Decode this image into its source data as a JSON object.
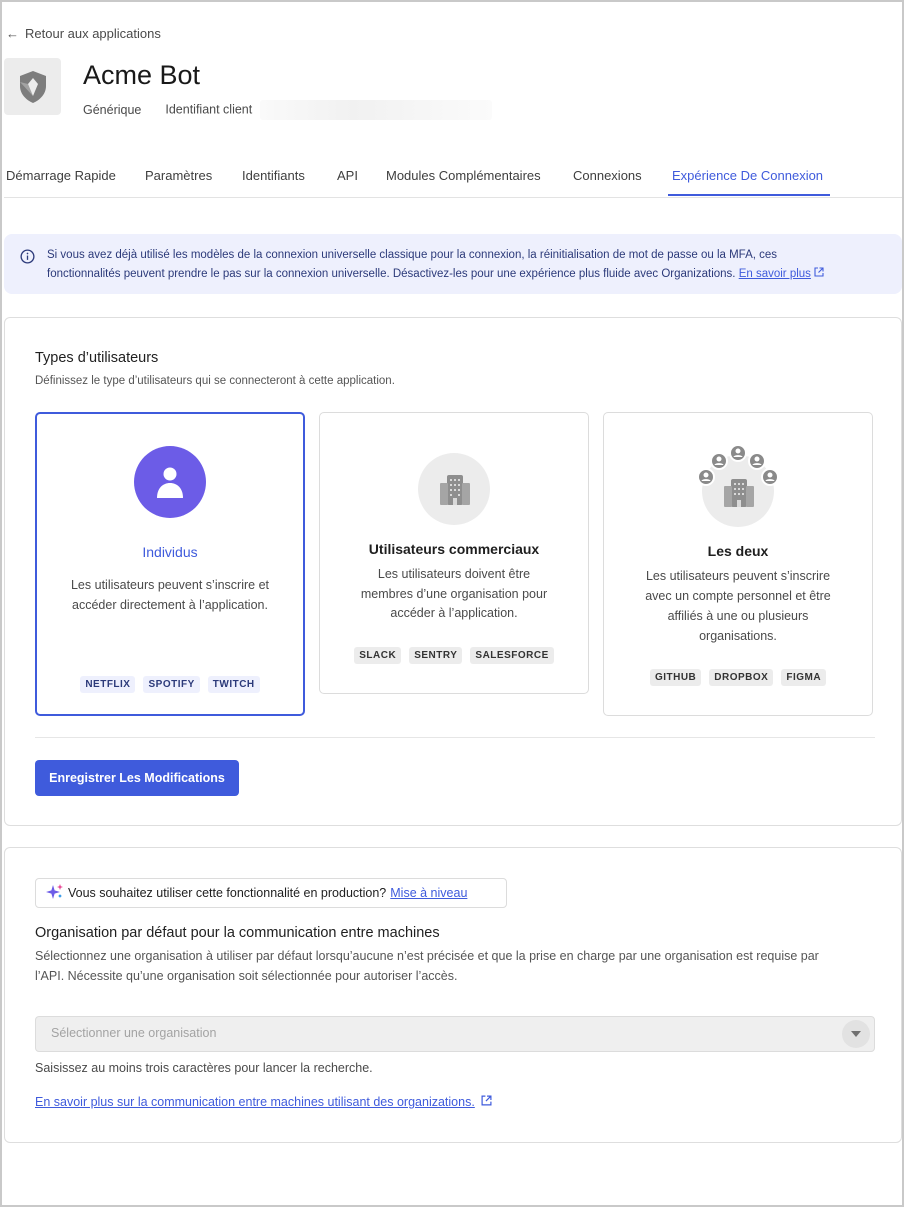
{
  "nav": {
    "back_label": "Retour aux applications"
  },
  "app": {
    "name": "Acme Bot",
    "type": "Générique",
    "client_id_label": "Identifiant client"
  },
  "tabs": [
    {
      "label": "Démarrage Rapide"
    },
    {
      "label": "Paramètres"
    },
    {
      "label": "Identifiants"
    },
    {
      "label": "API"
    },
    {
      "label": "Modules Complémentaires"
    },
    {
      "label": "Connexions"
    },
    {
      "label": "Expérience De Connexion",
      "active": true
    }
  ],
  "banner": {
    "line1": "Si vous avez déjà utilisé les modèles de la connexion universelle classique pour la connexion, la réinitialisation de mot de passe ou la MFA, ces",
    "line2": "fonctionnalités peuvent prendre le pas sur la connexion universelle. Désactivez-les pour une expérience plus fluide avec Organizations.",
    "link": "En savoir plus"
  },
  "user_types": {
    "title": "Types d’utilisateurs",
    "subtitle": "Définissez le type d’utilisateurs qui se connecteront à cette application.",
    "options": [
      {
        "title": "Individus",
        "desc_lines": [
          "Les utilisateurs peuvent s’inscrire et",
          "accéder directement à l’application."
        ],
        "chips": [
          "NETFLIX",
          "SPOTIFY",
          "TWITCH"
        ],
        "selected": true
      },
      {
        "title": "Utilisateurs commerciaux",
        "desc_lines": [
          "Les utilisateurs doivent être",
          "membres d’une organisation pour",
          "accéder à l’application."
        ],
        "chips": [
          "SLACK",
          "SENTRY",
          "SALESFORCE"
        ],
        "selected": false
      },
      {
        "title": "Les deux",
        "desc_lines": [
          "Les utilisateurs peuvent s’inscrire",
          "avec un compte personnel et être",
          "affiliés à une ou plusieurs",
          "organisations."
        ],
        "chips": [
          "GITHUB",
          "DROPBOX",
          "FIGMA"
        ],
        "selected": false
      }
    ],
    "save_label": "Enregistrer Les Modifications"
  },
  "m2m": {
    "upgrade_text": "Vous souhaitez utiliser cette fonctionnalité en production?",
    "upgrade_link": "Mise à niveau",
    "title": "Organisation par défaut pour la communication entre machines",
    "desc_line1": "Sélectionnez une organisation à utiliser par défaut lorsqu’aucune n’est précisée et que la prise en charge par une organisation est requise par",
    "desc_line2": "l’API. Nécessite qu’une organisation soit sélectionnée pour autoriser l’accès.",
    "select_placeholder": "Sélectionner une organisation",
    "hint": "Saisissez au moins trois caractères pour lancer la recherche.",
    "learn_link": "En savoir plus sur la communication entre machines utilisant des organizations."
  },
  "colors": {
    "accent": "#3f5bdc",
    "banner_bg": "#eef0fd",
    "avatar_purple": "#6c5ce7"
  }
}
